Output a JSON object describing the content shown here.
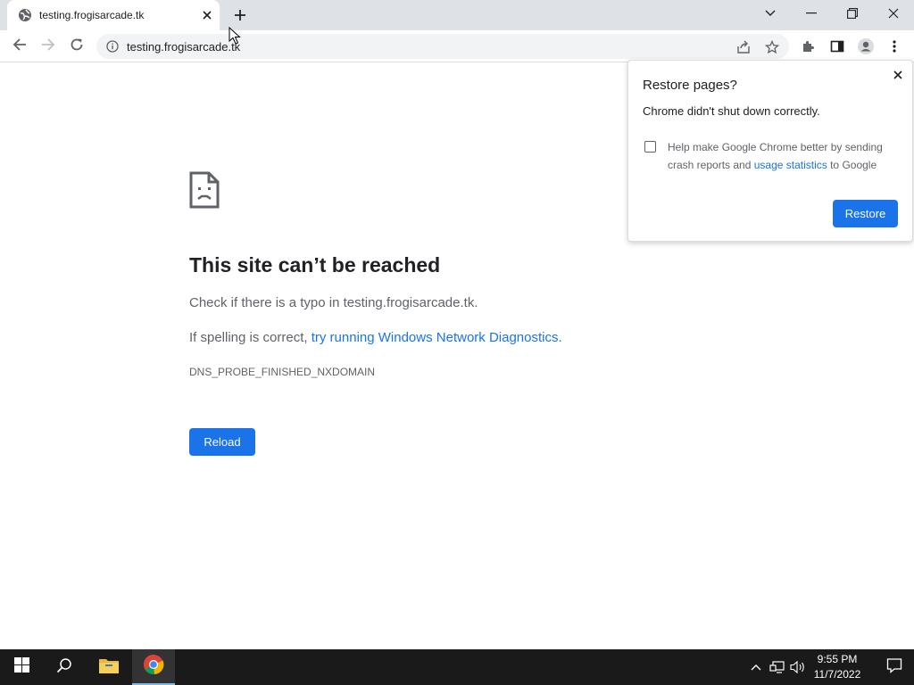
{
  "tab": {
    "title": "testing.frogisarcade.tk"
  },
  "toolbar": {
    "url": "testing.frogisarcade.tk"
  },
  "error_page": {
    "title": "This site can’t be reached",
    "line1": "Check if there is a typo in testing.frogisarcade.tk.",
    "line2_prefix": "If spelling is correct, ",
    "line2_link": "try running Windows Network Diagnostics",
    "line2_suffix": ".",
    "error_code": "DNS_PROBE_FINISHED_NXDOMAIN",
    "reload_label": "Reload"
  },
  "restore_bubble": {
    "title": "Restore pages?",
    "message": "Chrome didn't shut down correctly.",
    "checkbox_text_prefix": "Help make Google Chrome better by sending crash reports and ",
    "checkbox_link": "usage statistics",
    "checkbox_text_suffix": " to Google",
    "checkbox_checked": false,
    "restore_label": "Restore"
  },
  "taskbar": {
    "time": "9:55 PM",
    "date": "11/7/2022",
    "apps": [
      "file-explorer-icon",
      "chrome-icon"
    ],
    "active_app": "chrome-icon"
  },
  "colors": {
    "accent": "#1a73e8",
    "tabstrip": "#dee1e6",
    "taskbar": "#1a1a1a"
  }
}
